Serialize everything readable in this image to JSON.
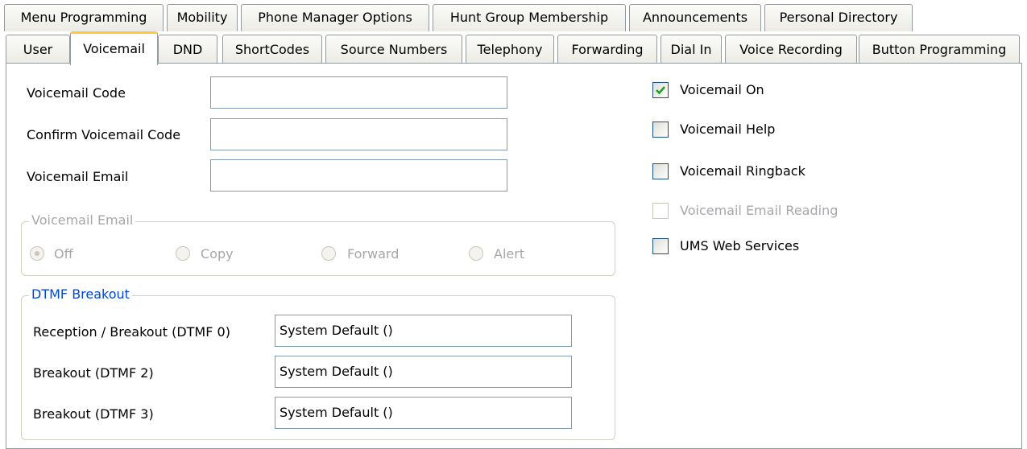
{
  "tabs_row1": [
    "Menu Programming",
    "Mobility",
    "Phone Manager Options",
    "Hunt Group Membership",
    "Announcements",
    "Personal Directory"
  ],
  "tabs_row2": [
    "User",
    "Voicemail",
    "DND",
    "ShortCodes",
    "Source Numbers",
    "Telephony",
    "Forwarding",
    "Dial In",
    "Voice Recording",
    "Button Programming"
  ],
  "active_tab": "Voicemail",
  "fields": {
    "voicemail_code": {
      "label": "Voicemail Code",
      "value": ""
    },
    "confirm_voicemail_code": {
      "label": "Confirm Voicemail Code",
      "value": ""
    },
    "voicemail_email": {
      "label": "Voicemail Email",
      "value": ""
    }
  },
  "email_group": {
    "legend": "Voicemail Email",
    "options": [
      "Off",
      "Copy",
      "Forward",
      "Alert"
    ],
    "selected": "Off",
    "enabled": false
  },
  "dtmf_group": {
    "legend": "DTMF Breakout",
    "legend_color": "#0046d5",
    "rows": [
      {
        "label": "Reception / Breakout (DTMF 0)",
        "value": "System Default ()"
      },
      {
        "label": "Breakout (DTMF 2)",
        "value": "System Default ()"
      },
      {
        "label": "Breakout (DTMF 3)",
        "value": "System Default ()"
      }
    ]
  },
  "checkboxes": [
    {
      "label": "Voicemail On",
      "checked": true,
      "enabled": true
    },
    {
      "label": "Voicemail Help",
      "checked": false,
      "enabled": true
    },
    {
      "label": "Voicemail Ringback",
      "checked": false,
      "enabled": true
    },
    {
      "label": "Voicemail Email Reading",
      "checked": false,
      "enabled": false
    },
    {
      "label": "UMS Web Services",
      "checked": false,
      "enabled": true
    }
  ],
  "colors": {
    "active_tab_accent": "#ffc83c",
    "check_mark": "#21a121"
  }
}
